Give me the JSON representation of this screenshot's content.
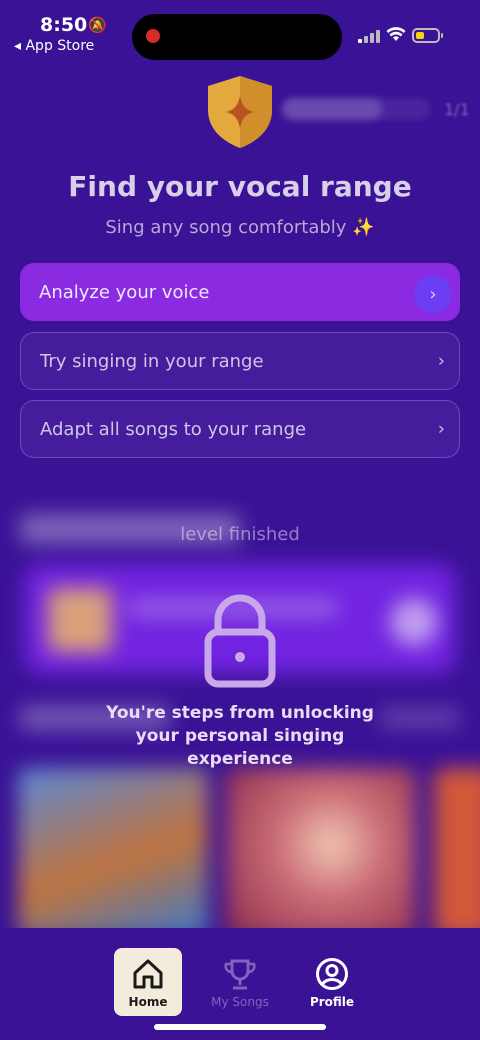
{
  "status_bar": {
    "time": "8:50",
    "back_label": "◂ App Store"
  },
  "header": {
    "progress_count": "1/1",
    "title": "Find your vocal range",
    "subtitle": "Sing any song comfortably",
    "sparkle": "✨"
  },
  "options": [
    {
      "label": "Analyze your voice"
    },
    {
      "label": "Try singing in your range"
    },
    {
      "label": "Adapt all songs to your range"
    }
  ],
  "locked": {
    "level_text": "level finished",
    "message": "You're steps from unlocking your personal singing experience"
  },
  "tabs": [
    {
      "label": "Home",
      "state": "active"
    },
    {
      "label": "My Songs",
      "state": "inactive"
    },
    {
      "label": "Profile",
      "state": "inactive"
    }
  ],
  "colors": {
    "background": "#3a1296",
    "primary_button": "#8a2be2",
    "accent": "#6c3df2"
  }
}
